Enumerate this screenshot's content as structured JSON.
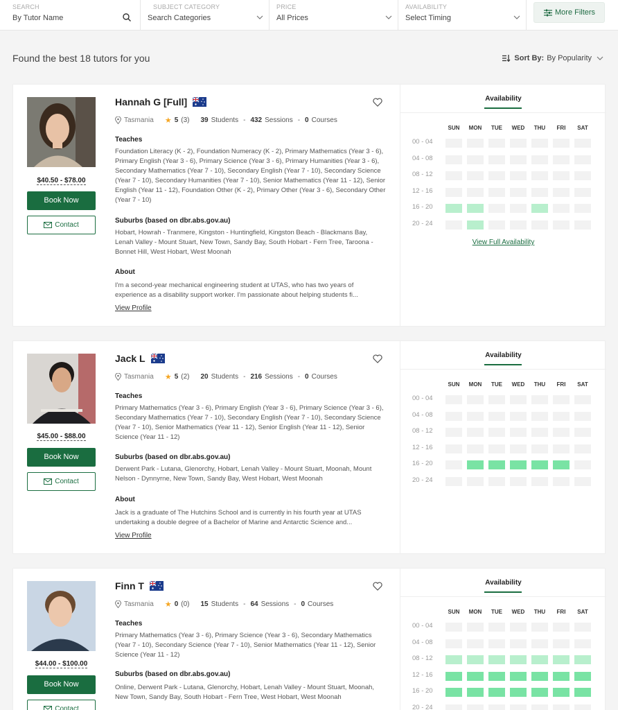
{
  "filters": {
    "search": {
      "label": "SEARCH",
      "placeholder": "By Tutor Name"
    },
    "subject": {
      "label": "SUBJECT CATEGORY",
      "value": "Search Categories"
    },
    "price": {
      "label": "PRICE",
      "value": "All Prices"
    },
    "availability": {
      "label": "AVAILABILITY",
      "value": "Select Timing"
    },
    "more_filters": "More Filters"
  },
  "results": {
    "found_text": "Found the best 18 tutors for you",
    "sort_label": "Sort By:",
    "sort_value": "By Popularity"
  },
  "colors": {
    "brand": "#1a6d40",
    "avail_light": "#b8efcd",
    "avail_strong": "#79e3a4",
    "star": "#f5a623"
  },
  "labels": {
    "teaches": "Teaches",
    "suburbs": "Suburbs (based on dbr.abs.gov.au)",
    "about": "About",
    "view_profile": "View Profile",
    "book_now": "Book Now",
    "contact": "Contact",
    "availability": "Availability",
    "view_full": "View Full Availability",
    "students": "Students",
    "sessions": "Sessions",
    "courses": "Courses"
  },
  "days": [
    "SUN",
    "MON",
    "TUE",
    "WED",
    "THU",
    "FRI",
    "SAT"
  ],
  "slots": [
    "00 - 04",
    "04 - 08",
    "08 - 12",
    "12 - 16",
    "16 - 20",
    "20 - 24"
  ],
  "tutors": [
    {
      "name": "Hannah G [Full]",
      "flag": "Australia",
      "location": "Tasmania",
      "rating": "5",
      "reviews": "(3)",
      "students": "39",
      "sessions": "432",
      "courses": "0",
      "price": "$40.50 - $78.00",
      "teaches": "Foundation Literacy (K - 2), Foundation Numeracy (K - 2), Primary Mathematics (Year 3 - 6), Primary English (Year 3 - 6), Primary Science (Year 3 - 6), Primary Humanities (Year 3 - 6), Secondary Mathematics (Year 7 - 10), Secondary English (Year 7 - 10), Secondary Science (Year 7 - 10), Secondary Humanities (Year 7 - 10), Senior Mathematics (Year 11 - 12), Senior English (Year 11 - 12), Foundation Other (K - 2), Primary Other (Year 3 - 6), Secondary Other (Year 7 - 10)",
      "suburbs": "Hobart, Howrah - Tranmere, Kingston - Huntingfield, Kingston Beach - Blackmans Bay, Lenah Valley - Mount Stuart, New Town, Sandy Bay, South Hobart - Fern Tree, Taroona - Bonnet Hill, West Hobart, West Moonah",
      "about": "I'm a second-year mechanical engineering student at UTAS, who has two years of experience as a disability support worker. I'm passionate about helping students fi...",
      "grid": [
        [
          0,
          0,
          0,
          0,
          0,
          0,
          0
        ],
        [
          0,
          0,
          0,
          0,
          0,
          0,
          0
        ],
        [
          0,
          0,
          0,
          0,
          0,
          0,
          0
        ],
        [
          0,
          0,
          0,
          0,
          0,
          0,
          0
        ],
        [
          1,
          1,
          0,
          0,
          1,
          0,
          0
        ],
        [
          0,
          1,
          0,
          0,
          0,
          0,
          0
        ]
      ]
    },
    {
      "name": "Jack L",
      "flag": "Australia",
      "location": "Tasmania",
      "rating": "5",
      "reviews": "(2)",
      "students": "20",
      "sessions": "216",
      "courses": "0",
      "price": "$45.00 - $88.00",
      "teaches": "Primary Mathematics (Year 3 - 6), Primary English (Year 3 - 6), Primary Science (Year 3 - 6), Secondary Mathematics (Year 7 - 10), Secondary English (Year 7 - 10), Secondary Science (Year 7 - 10), Senior Mathematics (Year 11 - 12), Senior English (Year 11 - 12), Senior Science (Year 11 - 12)",
      "suburbs": "Derwent Park - Lutana, Glenorchy, Hobart, Lenah Valley - Mount Stuart, Moonah, Mount Nelson - Dynnyrne, New Town, Sandy Bay, West Hobart, West Moonah",
      "about": "Jack is a graduate of The Hutchins School and is currently in his fourth year at UTAS undertaking a double degree of a Bachelor of Marine and Antarctic Science and...",
      "grid": [
        [
          0,
          0,
          0,
          0,
          0,
          0,
          0
        ],
        [
          0,
          0,
          0,
          0,
          0,
          0,
          0
        ],
        [
          0,
          0,
          0,
          0,
          0,
          0,
          0
        ],
        [
          0,
          0,
          0,
          0,
          0,
          0,
          0
        ],
        [
          0,
          2,
          2,
          2,
          2,
          2,
          0
        ],
        [
          0,
          0,
          0,
          0,
          0,
          0,
          0
        ]
      ]
    },
    {
      "name": "Finn T",
      "flag": "Australia",
      "location": "Tasmania",
      "rating": "0",
      "reviews": "(0)",
      "students": "15",
      "sessions": "64",
      "courses": "0",
      "price": "$44.00 - $100.00",
      "teaches": "Primary Mathematics (Year 3 - 6), Primary Science (Year 3 - 6), Secondary Mathematics (Year 7 - 10), Secondary Science (Year 7 - 10), Senior Mathematics (Year 11 - 12), Senior Science (Year 11 - 12)",
      "suburbs": "Online, Derwent Park - Lutana, Glenorchy, Hobart, Lenah Valley - Mount Stuart, Moonah, New Town, Sandy Bay, South Hobart - Fern Tree, West Hobart, West Moonah",
      "about": "",
      "grid": [
        [
          0,
          0,
          0,
          0,
          0,
          0,
          0
        ],
        [
          0,
          0,
          0,
          0,
          0,
          0,
          0
        ],
        [
          1,
          1,
          1,
          1,
          1,
          1,
          1
        ],
        [
          2,
          2,
          2,
          2,
          2,
          2,
          2
        ],
        [
          2,
          2,
          2,
          2,
          2,
          2,
          2
        ],
        [
          0,
          0,
          0,
          0,
          0,
          0,
          0
        ]
      ]
    }
  ]
}
